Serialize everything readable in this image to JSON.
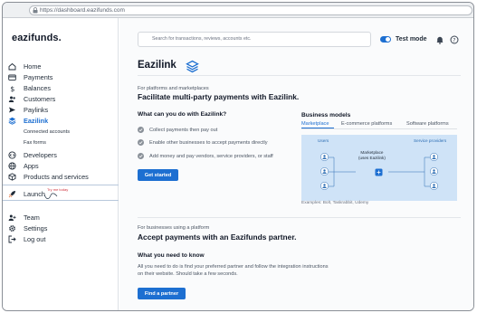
{
  "browser": {
    "url": "https://dashboard.eazifunds.com"
  },
  "sidebar": {
    "logo": "eazifunds.",
    "items": [
      {
        "label": "Home"
      },
      {
        "label": "Payments"
      },
      {
        "label": "Balances"
      },
      {
        "label": "Customers"
      },
      {
        "label": "Paylinks"
      },
      {
        "label": "Eazilink"
      },
      {
        "label": "Connected accounts"
      },
      {
        "label": "Fax forms"
      },
      {
        "label": "Developers"
      },
      {
        "label": "Apps"
      },
      {
        "label": "Products and services"
      },
      {
        "label": "Launch"
      },
      {
        "label": "Team"
      },
      {
        "label": "Settings"
      },
      {
        "label": "Log out"
      }
    ],
    "launch_tip": "Try me today",
    "active_color": "#1d6fd1"
  },
  "header": {
    "search_placeholder": "Search for transactions, reviews, accounts etc.",
    "test_mode_label": "Test mode",
    "test_mode_on": true
  },
  "main": {
    "title": "Eazilink",
    "platform_section": {
      "eyebrow": "For platforms and marketplaces",
      "headline": "Facilitate multi-party payments with Eazilink.",
      "question": "What can you do with Eazilink?",
      "features": [
        "Collect payments then pay out",
        "Enable other businesses to accept payments directly",
        "Add money and pay vendors, service providers, or staff"
      ],
      "cta": "Get started"
    },
    "business_models": {
      "title": "Business models",
      "tabs": [
        "Marketplace",
        "E-commerce platforms",
        "Software platforms"
      ],
      "active_tab": "Marketplace",
      "diagram": {
        "left_label": "Users",
        "right_label": "Service providers",
        "center_line1": "Marketplace",
        "center_line2": "(uses Eazilink)"
      },
      "examples": "Examples: Bolt, Taskrabbit, Udemy"
    },
    "partner_section": {
      "eyebrow": "For businesses using a platform",
      "headline": "Accept payments with an Eazifunds partner.",
      "subhead": "What you need to know",
      "body": "All you need to do is find your preferred partner and follow the integration instructions on their website. Should take a few seconds.",
      "cta": "Find a partner"
    }
  }
}
